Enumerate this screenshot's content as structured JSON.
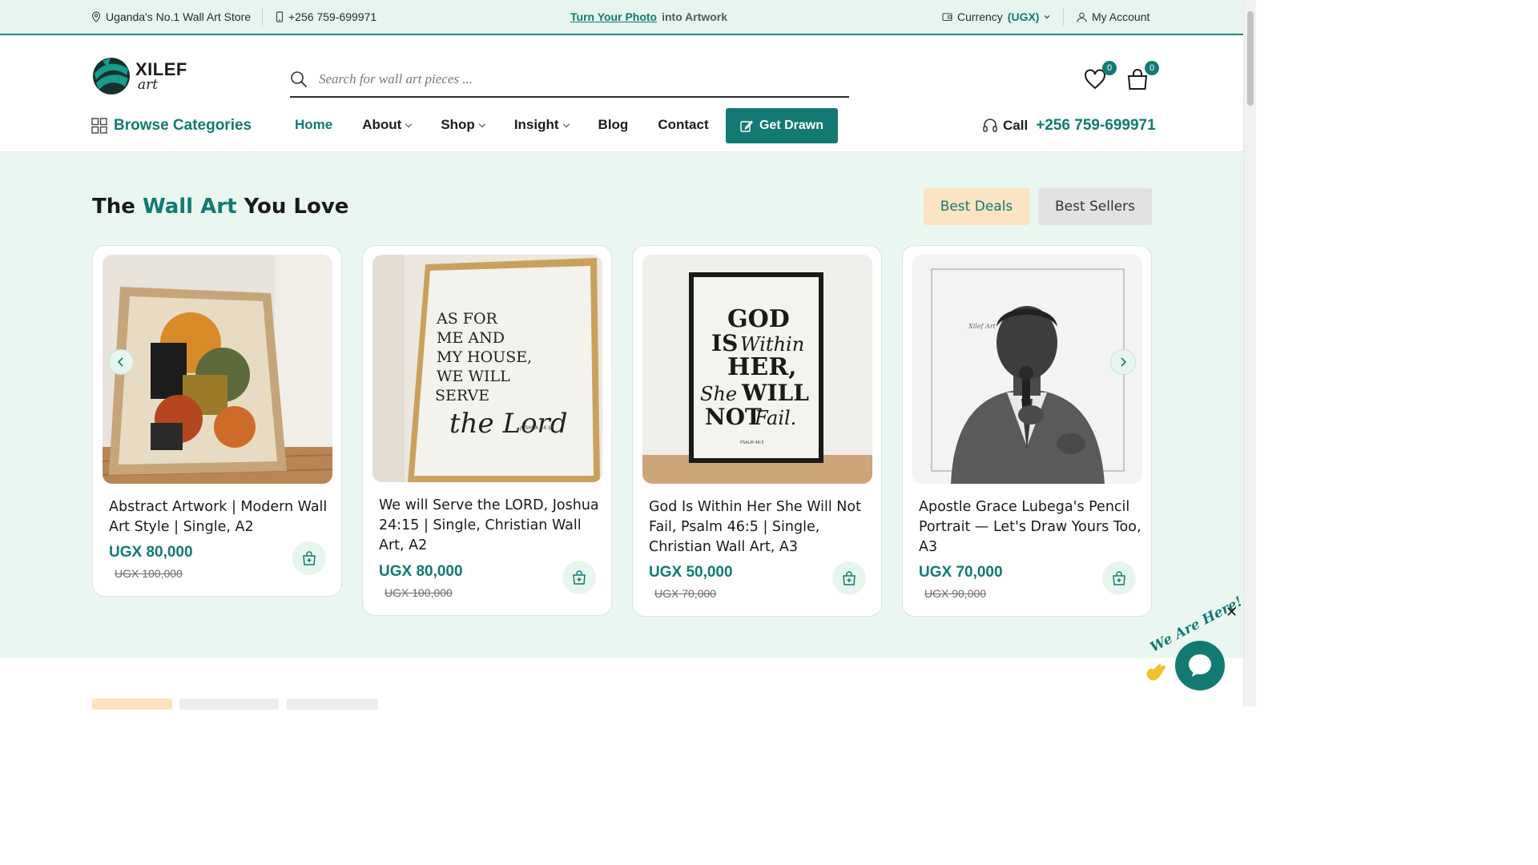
{
  "topbar": {
    "store_tag": "Uganda's No.1 Wall Art Store",
    "phone": "+256 759-699971",
    "promo_link": "Turn Your Photo",
    "promo_rest": "into Artwork",
    "currency_label": "Currency",
    "currency_value": "(UGX)",
    "account": "My Account"
  },
  "header": {
    "logo_word": "XILEF",
    "logo_sub": "art",
    "search_placeholder": "Search for wall art pieces ...",
    "wishlist_count": "0",
    "cart_count": "0"
  },
  "nav": {
    "browse": "Browse Categories",
    "items": [
      "Home",
      "About",
      "Shop",
      "Insight",
      "Blog",
      "Contact"
    ],
    "cta": "Get Drawn",
    "call_label": "Call",
    "call_number": "+256 759-699971"
  },
  "section": {
    "title_pre": "The",
    "title_accent": "Wall Art",
    "title_post": "You Love",
    "tab_deals": "Best Deals",
    "tab_sellers": "Best Sellers"
  },
  "products": [
    {
      "title": "Abstract Artwork | Modern Wall Art Style | Single, A2",
      "price": "UGX 80,000",
      "old_price": "UGX 100,000"
    },
    {
      "title": "We will Serve the LORD, Joshua 24:15 | Single, Christian Wall Art, A2",
      "price": "UGX 80,000",
      "old_price": "UGX 100,000",
      "art_lines": [
        "AS FOR",
        "ME AND",
        "MY HOUSE,",
        "WE WILL",
        "SERVE"
      ],
      "art_script": "the Lord",
      "art_ref": "JOSHUA 24:15"
    },
    {
      "title": "God Is Within Her She Will Not Fail, Psalm 46:5 | Single, Christian Wall Art, A3",
      "price": "UGX 50,000",
      "old_price": "UGX 70,000",
      "art_lines": [
        "GOD",
        "IS",
        "Within",
        "HER,",
        "She",
        "WILL",
        "NOT",
        "Fail."
      ],
      "art_ref": "PSALM 46:5"
    },
    {
      "title": "Apostle Grace Lubega's Pencil Portrait — Let's Draw Yours Too, A3",
      "price": "UGX 70,000",
      "old_price": "UGX 90,000",
      "art_signature": "Xilef Art"
    }
  ],
  "chat": {
    "tag": "We Are Here!",
    "close": "✕"
  },
  "colors": {
    "brand": "#127a72",
    "mint_bg": "#e9f7f0",
    "deals_bg": "#fce3c2"
  }
}
